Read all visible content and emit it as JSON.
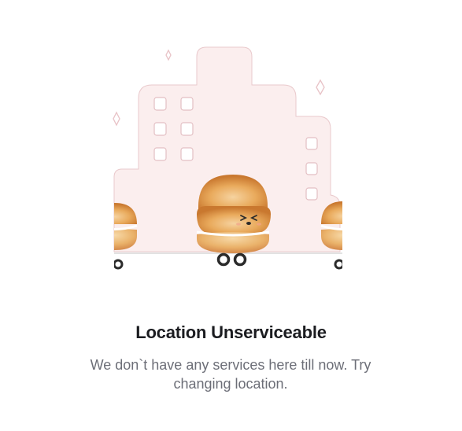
{
  "empty_state": {
    "title": "Location Unserviceable",
    "message": "We don`t have any services here till now. Try changing location."
  },
  "illustration": {
    "icon": "burger-delivery-city-illustration"
  },
  "colors": {
    "title": "#1b1c20",
    "message": "#6c6e77",
    "building_fill": "#fbeeee",
    "bun": "#e8a85a",
    "wheel": "#2b2b2b"
  }
}
